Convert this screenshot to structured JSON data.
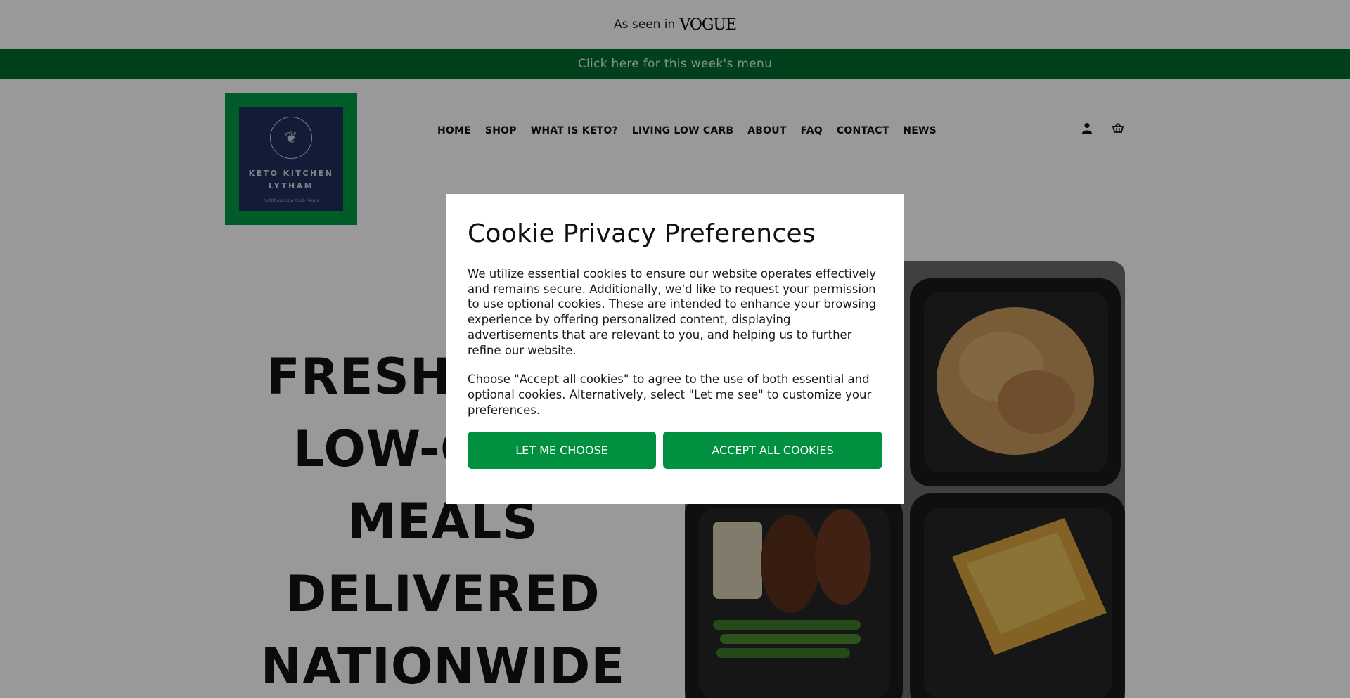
{
  "announcement": {
    "prefix": "As seen in",
    "brand": "VOGUE"
  },
  "menu_banner": {
    "label": "Click here for this week's menu"
  },
  "logo": {
    "title_line1": "KETO KITCHEN",
    "title_line2": "LYTHAM",
    "subtitle": "Nutritious Low Carb Meals"
  },
  "nav": {
    "items": [
      "HOME",
      "SHOP",
      "WHAT IS KETO?",
      "LIVING LOW CARB",
      "ABOUT",
      "FAQ",
      "CONTACT",
      "NEWS"
    ]
  },
  "header_icons": [
    "account-icon",
    "basket-icon"
  ],
  "hero": {
    "lines": [
      "FRESH KETO",
      "LOW-CARB",
      "MEALS",
      "DELIVERED",
      "NATIONWIDE"
    ]
  },
  "cookie_modal": {
    "title": "Cookie Privacy Preferences",
    "paragraph1": "We utilize essential cookies to ensure our website operates effectively and remains secure. Additionally, we'd like to request your permission to use optional cookies. These are intended to enhance your browsing experience by offering personalized content, displaying advertisements that are relevant to you, and helping us to further refine our website.",
    "paragraph2": "Choose \"Accept all cookies\" to agree to the use of both essential and optional cookies. Alternatively, select \"Let me see\" to customize your preferences.",
    "choose_label": "LET ME CHOOSE",
    "accept_label": "ACCEPT ALL COOKIES"
  },
  "colors": {
    "banner_green": "#006b2c",
    "button_green": "#009040",
    "logo_navy": "#1f2f5c"
  }
}
